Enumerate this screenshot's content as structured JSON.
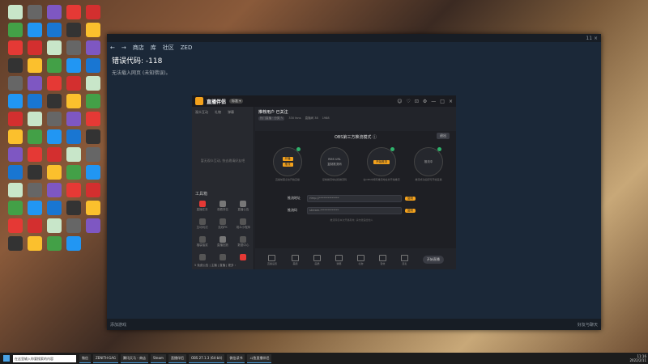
{
  "desktop": {
    "icons": [
      {
        "label": "",
        "color": "#c8e6c9"
      },
      {
        "label": "",
        "color": "#43a047"
      },
      {
        "label": "",
        "color": "#e53935"
      },
      {
        "label": "",
        "color": "#333"
      },
      {
        "label": "",
        "color": "#666"
      },
      {
        "label": "",
        "color": "#2196f3"
      },
      {
        "label": "",
        "color": "#d32f2f"
      },
      {
        "label": "",
        "color": "#fbc02d"
      },
      {
        "label": "",
        "color": "#7e57c2"
      },
      {
        "label": "",
        "color": "#1976d2"
      }
    ]
  },
  "steam": {
    "title_right": "11 ×",
    "nav": [
      "←",
      "→",
      "商店",
      "库",
      "社区",
      "ZED"
    ],
    "error_title": "错误代码: -118",
    "error_subtitle": "无法载入网页 (未知错误)。",
    "bottom_left": "添加游戏",
    "bottom_right": "好友与聊天"
  },
  "app": {
    "name": "直播伴侣",
    "version_badge": "标准 ▾",
    "window_controls": [
      "☺",
      "♡",
      "⊡",
      "⚙",
      "—",
      "□",
      "×"
    ],
    "left_tabs": [
      "观众互动",
      "礼物",
      "弹幕"
    ],
    "left_empty_text": "暂无观众互动, 快去邀请好友吧",
    "tools_title": "工具箱",
    "tools": [
      {
        "label": "直播任务",
        "color": "#e53935"
      },
      {
        "label": "观看排名",
        "color": "#777"
      },
      {
        "label": "直播公告",
        "color": "#777"
      },
      {
        "label": "互动玩法",
        "color": "#555"
      },
      {
        "label": "连线PK",
        "color": "#555"
      },
      {
        "label": "观众小程序",
        "color": "#555"
      },
      {
        "label": "福袋抽奖",
        "color": "#555"
      },
      {
        "label": "直播回放",
        "color": "#777"
      },
      {
        "label": "数据中心",
        "color": "#555"
      },
      {
        "label": "",
        "color": "#555"
      },
      {
        "label": "",
        "color": "#555"
      },
      {
        "label": "",
        "color": "#e53935"
      }
    ],
    "left_footer": "5 免费公告 | 主播 | 直播 | 更多 ›",
    "room_title": "推荐用户 已关注",
    "room_meta": [
      "热门直播 · 分类 ✎",
      "330 fans",
      "直播间 38",
      "1988"
    ],
    "mode_title": "OBS第三方推流模式 ⓘ",
    "exit_label": "退出",
    "steps": [
      {
        "top": "开播",
        "bottom": "推流",
        "desc": "直播前需点击开始直播",
        "done": true
      },
      {
        "top": "RMS URL",
        "bottom": "复制推流码",
        "desc": "复制推流地址和推流码",
        "done": false
      },
      {
        "top": "",
        "bottom": "开始推流",
        "desc": "在OBS中填写推流地址并开始推流",
        "done": true
      },
      {
        "top": "",
        "bottom": "推流中",
        "desc": "推流成功后即可开始直播",
        "done": true
      }
    ],
    "rows": [
      {
        "label": "推流地址",
        "value": "rtmp://**************",
        "button": "复制"
      },
      {
        "label": "推流码",
        "value": "stream-*************",
        "button": "复制"
      }
    ],
    "hint": "推流码仅本次开播有效, 请勿泄露给他人",
    "bottom_tools": [
      "直播设置",
      "美颜",
      "画质",
      "弹幕",
      "礼物",
      "音效",
      "连麦"
    ],
    "live_button": "开始直播"
  },
  "taskbar": {
    "search_placeholder": "在这里输入你要搜索的内容",
    "items": [
      "微信",
      "ZENITH·GAG",
      "腾讯天马 - 商店",
      "Steam",
      "直播伴侣",
      "OBS 27.1.3 (64-bit)",
      "微信读书",
      "斗鱼直播伴侣"
    ],
    "time": "11:16",
    "date": "2022/2/11"
  }
}
